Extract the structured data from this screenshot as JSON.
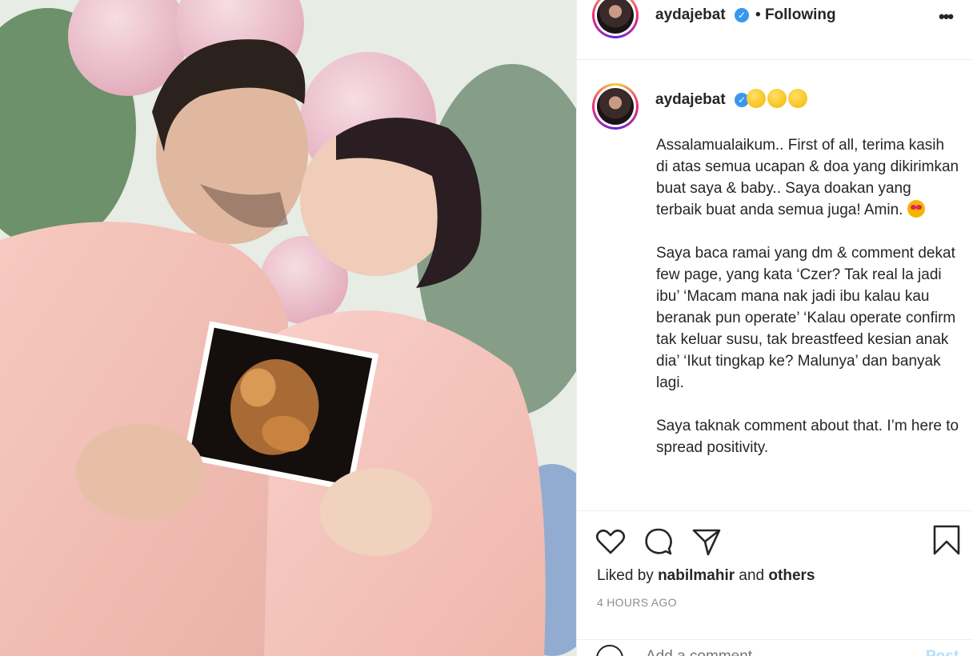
{
  "post": {
    "username": "aydajebat",
    "follow_status": "Following",
    "more_label": "•••",
    "dot_separator": "•",
    "verified_mark": "✓"
  },
  "caption": {
    "username": "aydajebat",
    "paragraph_1": "Assalamualaikum.. First of all, terima kasih di atas semua ucapan & doa yang dikirimkan buat saya & baby.. Saya doakan yang terbaik buat anda semua juga! Amin.",
    "paragraph_2": "Saya baca ramai yang dm & comment dekat few page, yang kata ‘Czer? Tak real la jadi ibu’ ‘Macam mana nak jadi ibu kalau kau beranak pun operate’ ‘Kalau operate confirm tak keluar susu, tak breastfeed kesian anak dia’ ‘Ikut tingkap ke? Malunya’ dan banyak lagi.",
    "paragraph_3": "Saya taknak comment about that. I’m here to spread positivity."
  },
  "likes": {
    "prefix": "Liked by",
    "user": "nabilmahir",
    "joiner": "and",
    "others": "others"
  },
  "timestamp": "4 HOURS AGO",
  "comment": {
    "placeholder": "Add a comment…",
    "post_label": "Post"
  },
  "icons": {
    "like": "heart-icon",
    "comment": "comment-icon",
    "share": "paper-plane-icon",
    "save": "bookmark-icon",
    "more": "more-options-icon",
    "emoji": "emoji-icon"
  },
  "colors": {
    "verified": "#3897f0",
    "muted": "#8e8e8e",
    "text": "#262626",
    "post_button": "#b2dffc"
  }
}
